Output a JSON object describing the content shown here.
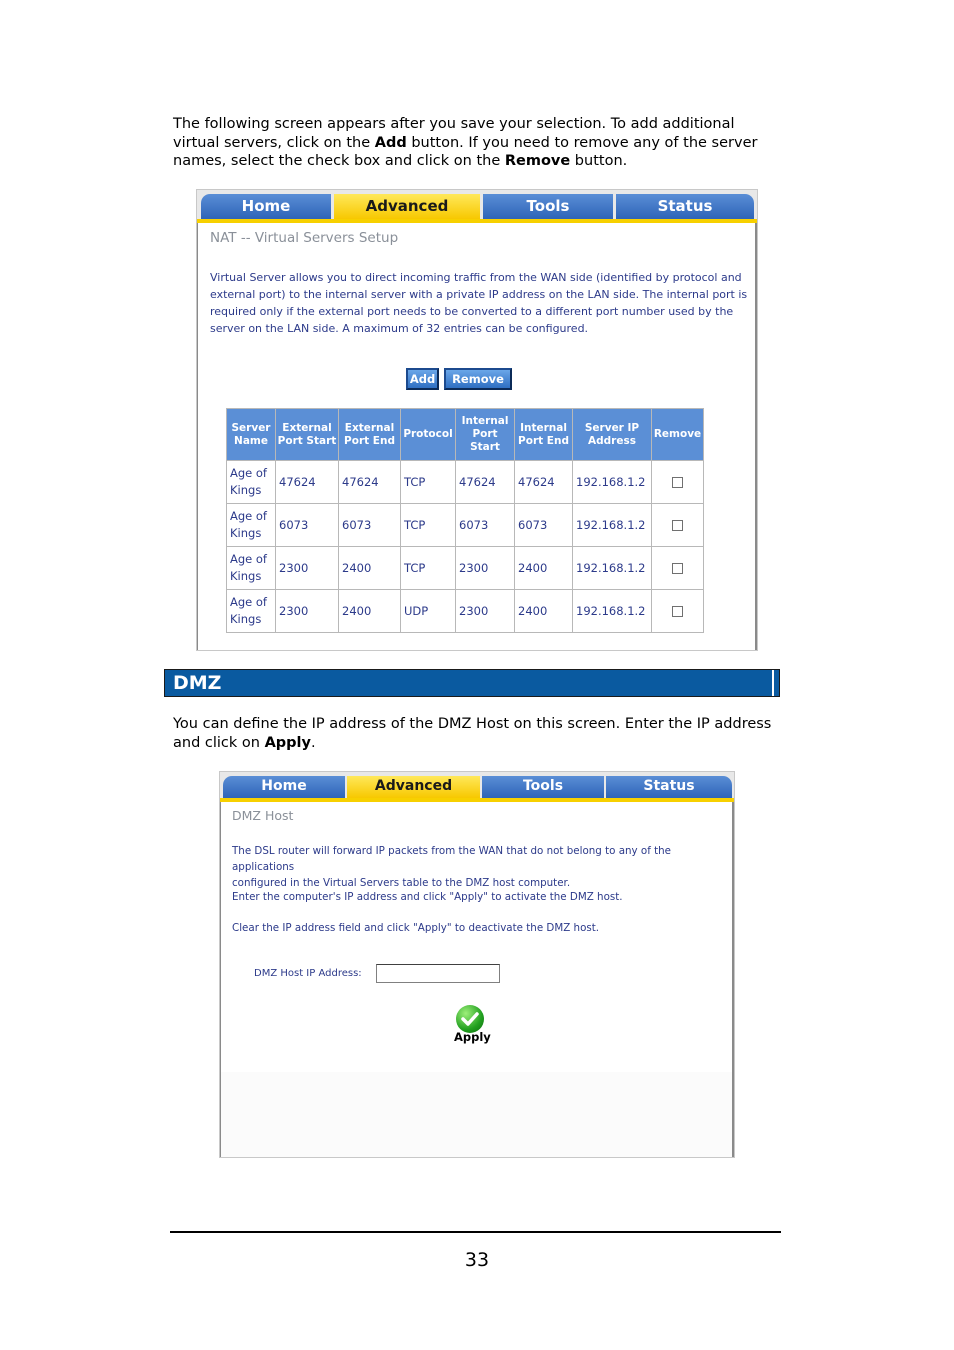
{
  "intro": {
    "line1": "The following screen appears after you save your selection. To add additional",
    "line2": "virtual servers, click on the ",
    "add_word": "Add",
    "line2b": " button. If you need to remove any of the server",
    "line3": "names, select the check box and click on the ",
    "remove_word": "Remove",
    "line3b": " button."
  },
  "nav": {
    "home": "Home",
    "advanced": "Advanced",
    "tools": "Tools",
    "status": "Status"
  },
  "vs": {
    "title": "NAT -- Virtual Servers Setup",
    "desc": [
      "Virtual Server allows you to direct incoming traffic from the WAN side (identified by protocol and",
      "external port) to the internal server with a private IP address on the LAN side. The internal port is",
      "required only if the external port needs to be converted to a different port number used by the",
      "server on the LAN side. A maximum of 32 entries can be configured."
    ],
    "add_label": "Add",
    "remove_label": "Remove",
    "headers": [
      "Server Name",
      "External Port Start",
      "External Port End",
      "Protocol",
      "Internal Port Start",
      "Internal Port End",
      "Server IP Address",
      "Remove"
    ],
    "rows": [
      [
        "Age of Kings",
        "47624",
        "47624",
        "TCP",
        "47624",
        "47624",
        "192.168.1.2"
      ],
      [
        "Age of Kings",
        "6073",
        "6073",
        "TCP",
        "6073",
        "6073",
        "192.168.1.2"
      ],
      [
        "Age of Kings",
        "2300",
        "2400",
        "TCP",
        "2300",
        "2400",
        "192.168.1.2"
      ],
      [
        "Age of Kings",
        "2300",
        "2400",
        "UDP",
        "2300",
        "2400",
        "192.168.1.2"
      ]
    ]
  },
  "dmz_heading": "DMZ",
  "dmz_intro": {
    "line1": "You can define the IP address of the DMZ Host on this screen. Enter the IP address",
    "line2": "and click on ",
    "apply_word": "Apply",
    "line2b": "."
  },
  "dmz": {
    "title": "DMZ Host",
    "desc1": "The DSL router will forward IP packets from the WAN that do not belong to any of the applications",
    "desc2": "configured in the Virtual Servers table to the DMZ host computer.",
    "desc3": "Enter the computer's IP address and click \"Apply\" to activate the DMZ host.",
    "desc4": "Clear the IP address field and click \"Apply\" to deactivate the DMZ host.",
    "ip_label": "DMZ Host IP Address:",
    "ip_value": "",
    "apply_label": "Apply"
  },
  "page_number": "33"
}
